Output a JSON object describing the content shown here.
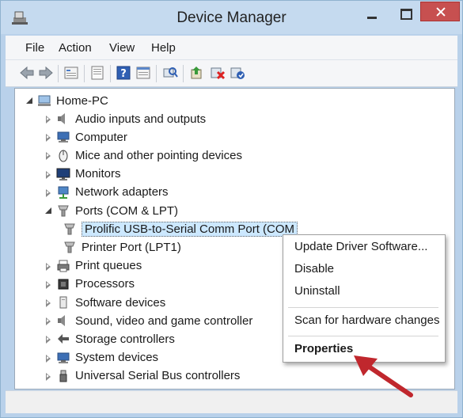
{
  "window": {
    "title": "Device Manager"
  },
  "menubar": {
    "items": [
      "File",
      "Action",
      "View",
      "Help"
    ]
  },
  "tree": {
    "root": "Home-PC",
    "items": [
      {
        "label": "Audio inputs and outputs",
        "icon": "speaker-icon",
        "state": "collapsed"
      },
      {
        "label": "Computer",
        "icon": "computer-icon",
        "state": "collapsed"
      },
      {
        "label": "Mice and other pointing devices",
        "icon": "mouse-icon",
        "state": "collapsed"
      },
      {
        "label": "Monitors",
        "icon": "monitor-icon",
        "state": "collapsed"
      },
      {
        "label": "Network adapters",
        "icon": "network-icon",
        "state": "collapsed"
      },
      {
        "label": "Ports (COM & LPT)",
        "icon": "port-icon",
        "state": "expanded"
      },
      {
        "label": "Prolific USB-to-Serial Comm Port (COM",
        "icon": "port-icon",
        "state": "child-selected"
      },
      {
        "label": "Printer Port (LPT1)",
        "icon": "port-icon",
        "state": "child"
      },
      {
        "label": "Print queues",
        "icon": "printer-icon",
        "state": "collapsed"
      },
      {
        "label": "Processors",
        "icon": "processor-icon",
        "state": "collapsed"
      },
      {
        "label": "Software devices",
        "icon": "software-icon",
        "state": "collapsed"
      },
      {
        "label": "Sound, video and game controller",
        "icon": "speaker-icon",
        "state": "collapsed"
      },
      {
        "label": "Storage controllers",
        "icon": "storage-icon",
        "state": "collapsed"
      },
      {
        "label": "System devices",
        "icon": "computer-icon",
        "state": "collapsed"
      },
      {
        "label": "Universal Serial Bus controllers",
        "icon": "usb-icon",
        "state": "collapsed"
      }
    ]
  },
  "context_menu": {
    "items": [
      "Update Driver Software...",
      "Disable",
      "Uninstall",
      "Scan for hardware changes",
      "Properties"
    ]
  },
  "colors": {
    "frame": "#b9d1ea",
    "close": "#c75050",
    "arrow": "#c0272d",
    "selection": "#cce8ff"
  }
}
